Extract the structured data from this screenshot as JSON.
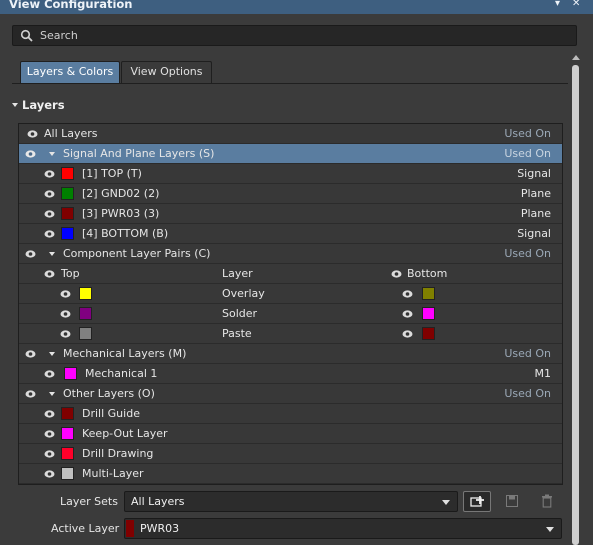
{
  "window": {
    "title": "View Configuration",
    "pin_glyph": "▾",
    "close_glyph": "✕"
  },
  "search": {
    "placeholder": "Search"
  },
  "tabs": [
    {
      "label": "Layers & Colors",
      "active": true
    },
    {
      "label": "View Options",
      "active": false
    }
  ],
  "layers_section": {
    "title": "Layers"
  },
  "layers": {
    "all": {
      "label": "All Layers",
      "status": "Used On"
    },
    "signal_group": {
      "label": "Signal And Plane Layers (S)",
      "status": "Used On"
    },
    "signal_rows": [
      {
        "label": "[1] TOP (T)",
        "type": "Signal",
        "color": "#ff0000"
      },
      {
        "label": "[2] GND02 (2)",
        "type": "Plane",
        "color": "#008000"
      },
      {
        "label": "[3] PWR03 (3)",
        "type": "Plane",
        "color": "#800000"
      },
      {
        "label": "[4] BOTTOM (B)",
        "type": "Signal",
        "color": "#0000ff"
      }
    ],
    "component_group": {
      "label": "Component Layer Pairs (C)",
      "status": "Used On"
    },
    "component_header": {
      "top": "Top",
      "layer": "Layer",
      "bottom": "Bottom"
    },
    "component_rows": [
      {
        "layer": "Overlay",
        "top_color": "#ffff00",
        "bottom_color": "#808000"
      },
      {
        "layer": "Solder",
        "top_color": "#800080",
        "bottom_color": "#ff00ff"
      },
      {
        "layer": "Paste",
        "top_color": "#808080",
        "bottom_color": "#800000"
      }
    ],
    "mechanical_group": {
      "label": "Mechanical Layers (M)",
      "status": "Used On"
    },
    "mechanical_rows": [
      {
        "label": "Mechanical 1",
        "short": "M1",
        "color": "#ff00ff"
      }
    ],
    "other_group": {
      "label": "Other Layers (O)",
      "status": "Used On"
    },
    "other_rows": [
      {
        "label": "Drill Guide",
        "color": "#800000"
      },
      {
        "label": "Keep-Out Layer",
        "color": "#ff00ff"
      },
      {
        "label": "Drill Drawing",
        "color": "#ff002a"
      },
      {
        "label": "Multi-Layer",
        "color": "#c0c0c0"
      }
    ]
  },
  "footer": {
    "layer_sets_label": "Layer Sets",
    "layer_sets_value": "All Layers",
    "active_layer_label": "Active Layer",
    "active_layer_value": "PWR03",
    "active_layer_color": "#800000"
  },
  "icons": {
    "eye": "eye-icon",
    "search": "search-icon",
    "add_layer_set": "add-layer-set-icon",
    "save": "save-icon",
    "delete": "trash-icon"
  }
}
